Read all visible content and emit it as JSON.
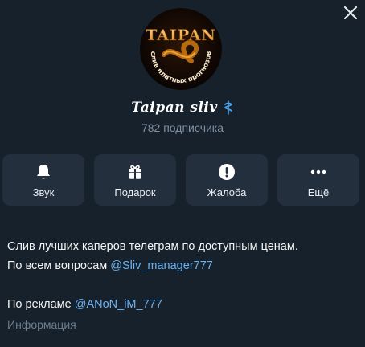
{
  "channel": {
    "name": "Taipan sliv",
    "subscribers": "782 подписчика",
    "avatar": {
      "logo_text": "TAIPAN",
      "ring_text": "слив платных прогнозов"
    }
  },
  "actions": [
    {
      "label": "Звук",
      "icon": "bell-icon"
    },
    {
      "label": "Подарок",
      "icon": "gift-icon"
    },
    {
      "label": "Жалоба",
      "icon": "report-icon"
    },
    {
      "label": "Ещё",
      "icon": "more-icon"
    }
  ],
  "description": {
    "line1": "Слив лучших каперов телеграм по доступным ценам.",
    "line2_prefix": "По всем вопросам ",
    "line2_link": "@Sliv_manager777",
    "line3_prefix": "По рекламе ",
    "line3_link": "@ANoN_iM_777",
    "caption": "Информация"
  },
  "colors": {
    "background": "#17212b",
    "button_bg": "#242f3d",
    "link": "#6ab2f2",
    "muted": "#7f91a4",
    "verified_badge": "#4fa3e8"
  }
}
